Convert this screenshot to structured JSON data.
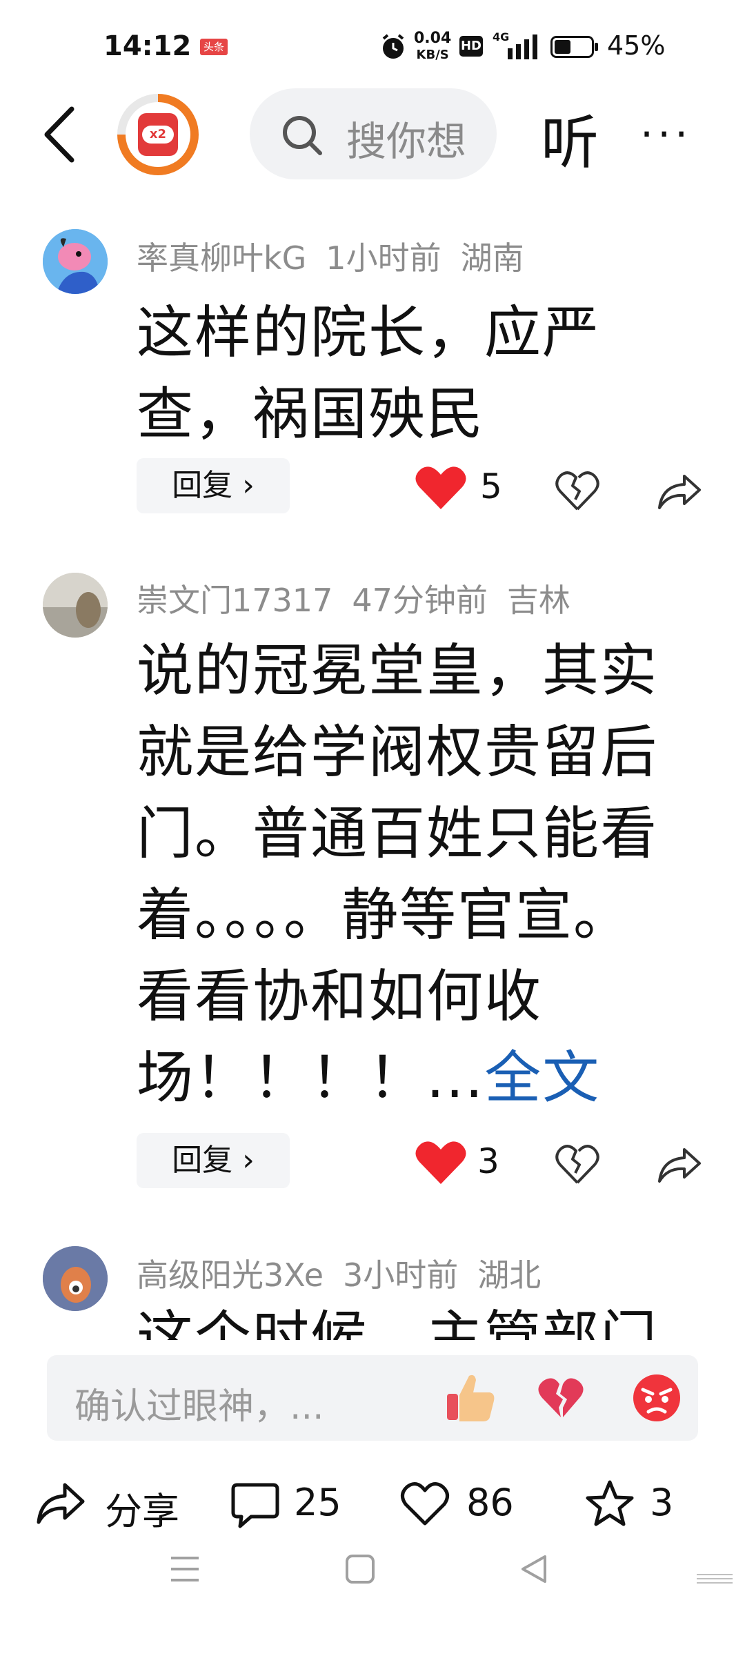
{
  "status_bar": {
    "time": "14:12",
    "news_badge": "头条",
    "net_speed_value": "0.04",
    "net_speed_unit": "KB/S",
    "hd": "HD",
    "signal": "4G",
    "battery": "45%",
    "battery_level": 0.45
  },
  "nav": {
    "search_placeholder": "搜你想",
    "avatar_badge": "x2",
    "listen": "听",
    "more": "···"
  },
  "comments": [
    {
      "user": "率真柳叶kG",
      "time": "1小时前",
      "location": "湖南",
      "text": "这样的院长，应严查，祸国殃民",
      "reply": "回复",
      "likes": "5",
      "full": ""
    },
    {
      "user": "崇文门17317",
      "time": "47分钟前",
      "location": "吉林",
      "text": "说的冠冕堂皇，其实就是给学阀权贵留后门。普通百姓只能看着。。。。静等官宣。看看协和如何收场！！！！...",
      "full": "全文",
      "reply": "回复",
      "likes": "3"
    },
    {
      "user": "高级阳光3Xe",
      "time": "3小时前",
      "location": "湖北",
      "text": "这个时候，主管部门"
    }
  ],
  "composer": {
    "placeholder": "确认过眼神，..."
  },
  "bottom_bar": {
    "share": "分享",
    "comments": "25",
    "likes": "86",
    "favorites": "3"
  },
  "colors": {
    "like_red": "#f0262e",
    "link_blue": "#1a5fb4",
    "meta_gray": "#8c8c8c",
    "accent_orange": "#f07b22"
  }
}
